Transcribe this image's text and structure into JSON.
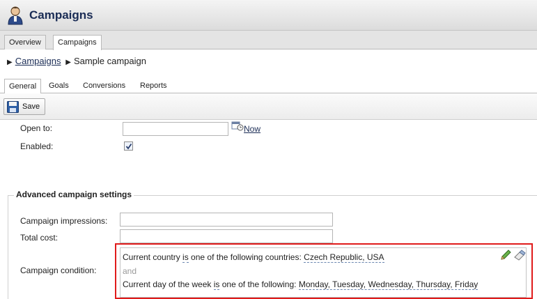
{
  "header": {
    "title": "Campaigns",
    "icon": "user-campaign-icon"
  },
  "main_tabs": [
    {
      "label": "Overview",
      "active": false
    },
    {
      "label": "Campaigns",
      "active": true
    }
  ],
  "breadcrumb": {
    "parent": "Campaigns",
    "current": "Sample campaign"
  },
  "sub_tabs": [
    {
      "label": "General",
      "active": true
    },
    {
      "label": "Goals",
      "active": false
    },
    {
      "label": "Conversions",
      "active": false
    },
    {
      "label": "Reports",
      "active": false
    }
  ],
  "toolbar": {
    "save_label": "Save"
  },
  "form": {
    "open_to_label": "Open to:",
    "open_to_value": "",
    "now_link": "Now",
    "enabled_label": "Enabled:",
    "enabled_checked": true
  },
  "advanced": {
    "legend": "Advanced campaign settings",
    "impressions_label": "Campaign impressions:",
    "impressions_value": "",
    "total_cost_label": "Total cost:",
    "total_cost_value": "",
    "condition_label": "Campaign condition:",
    "condition": {
      "line1_prefix": "Current country ",
      "line1_op": "is",
      "line1_mid": " one of the following countries: ",
      "line1_value": "Czech Republic, USA",
      "and_text": "and",
      "line2_prefix": "Current day of the week ",
      "line2_op": "is",
      "line2_mid": " one of the following: ",
      "line2_value": "Monday, Tuesday, Wednesday, Thursday, Friday"
    }
  },
  "colors": {
    "highlight_border": "#e01b1b",
    "link": "#1a2c55"
  }
}
